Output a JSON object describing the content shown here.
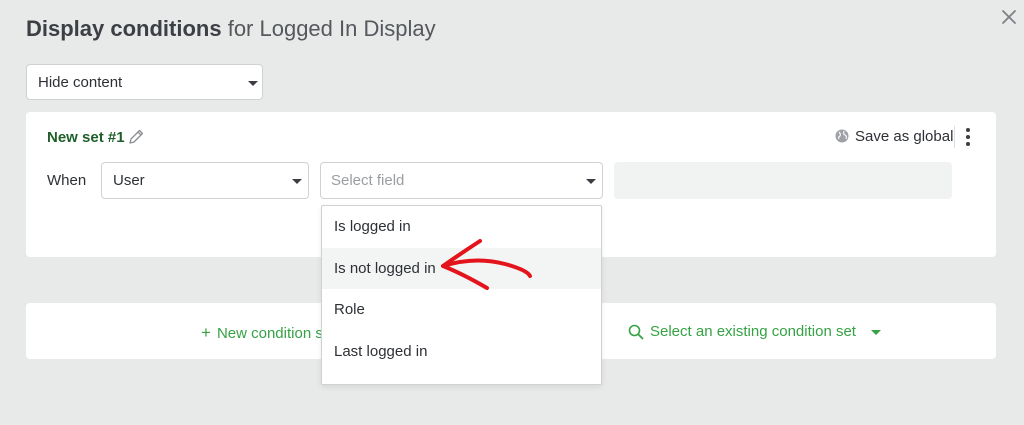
{
  "modal": {
    "title_bold": "Display conditions",
    "title_rest": " for Logged In Display",
    "mode_value": "Hide content"
  },
  "condition_set": {
    "name": "New set #1",
    "save_global_label": "Save as global",
    "when_label": "When",
    "source_value": "User",
    "field_placeholder": "Select field"
  },
  "field_options": [
    "Is logged in",
    "Is not logged in",
    "Role",
    "Last logged in"
  ],
  "highlighted_option": "Is not logged in",
  "bottom_bar": {
    "new_set_label": "New condition s",
    "existing_set_label": "Select an existing condition set"
  },
  "colors": {
    "accent_green": "#35a244",
    "set_name_green": "#1f5f2a",
    "annotation_red": "#e3141b"
  },
  "icons": {
    "close": "close-icon",
    "edit": "pencil-icon",
    "globe": "globe-icon",
    "more": "kebab-menu-icon",
    "add": "plus-icon",
    "search": "search-icon",
    "dropdown": "caret-down-icon",
    "annotation": "red-arrow-annotation"
  }
}
